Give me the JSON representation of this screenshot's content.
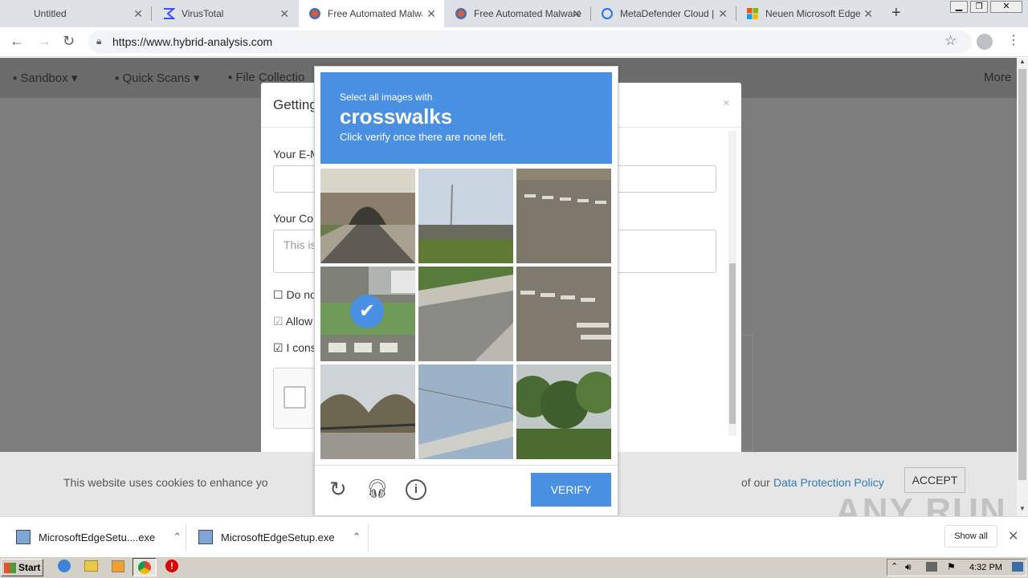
{
  "browser": {
    "tabs": [
      {
        "title": "Untitled",
        "active": false
      },
      {
        "title": "VirusTotal",
        "active": false
      },
      {
        "title": "Free Automated Malware",
        "active": true
      },
      {
        "title": "Free Automated Malware",
        "active": false
      },
      {
        "title": "MetaDefender Cloud | R",
        "active": false
      },
      {
        "title": "Neuen Microsoft Edge-B",
        "active": false
      }
    ],
    "url": "https://www.hybrid-analysis.com"
  },
  "site": {
    "nav": [
      "Sandbox",
      "Quick Scans",
      "File Collectio",
      "More"
    ],
    "modal": {
      "title": "Getting",
      "email_label": "Your E-M",
      "comment_label": "Your Con",
      "comment_placeholder": "This is",
      "checkbox1": "Do no",
      "checkbox2": "Allow",
      "checkbox3": "I cons"
    },
    "cookie": {
      "text_left": "This website uses cookies to enhance yo",
      "text_right": "of our",
      "policy_link": "Data Protection Policy",
      "accept": "ACCEPT"
    }
  },
  "captcha": {
    "line1": "Select all images with",
    "keyword": "crosswalks",
    "line3": "Click verify once there are none left.",
    "verify": "VERIFY",
    "selected_tile": 4
  },
  "downloads": {
    "items": [
      "MicrosoftEdgeSetu....exe",
      "MicrosoftEdgeSetup.exe"
    ],
    "show_all": "Show all"
  },
  "taskbar": {
    "start": "Start",
    "clock": "4:32 PM"
  },
  "watermark": "ANY RUN"
}
